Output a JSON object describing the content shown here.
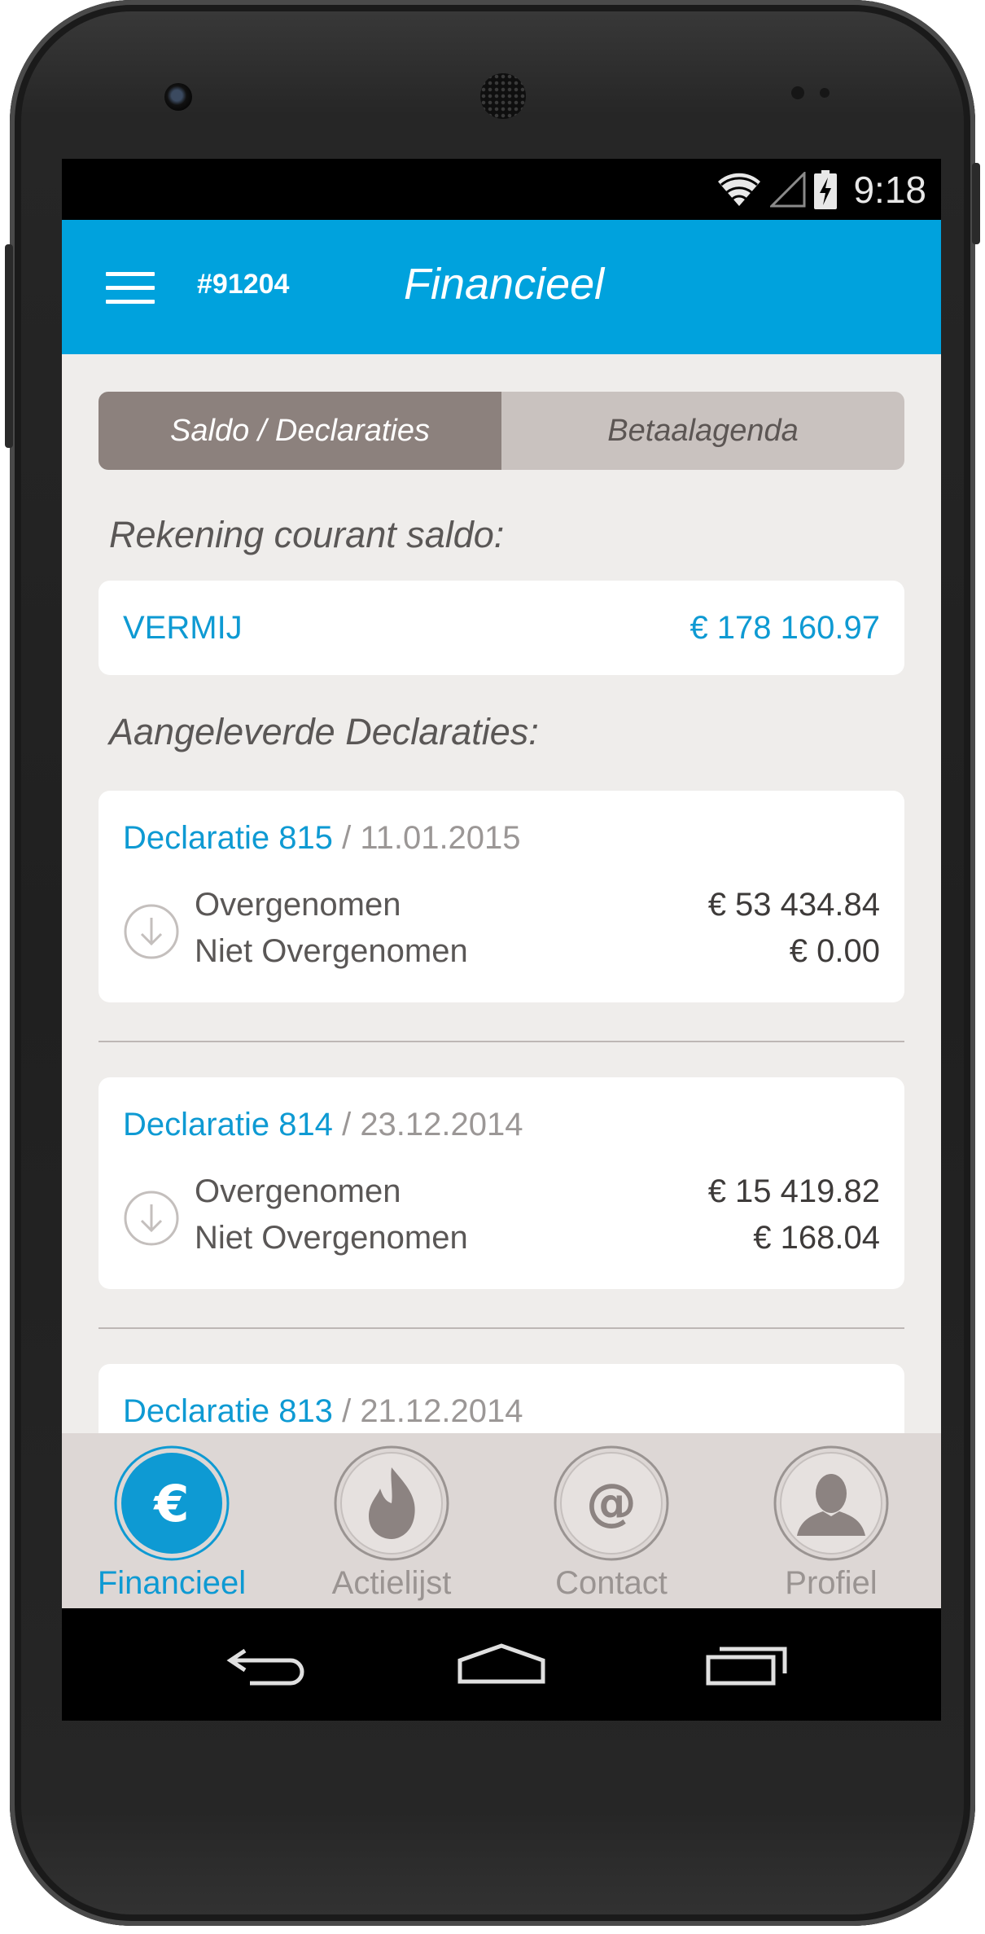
{
  "status_bar": {
    "time": "9:18",
    "icons": [
      "wifi-icon",
      "cellular-signal-icon",
      "battery-charging-icon"
    ]
  },
  "app_bar": {
    "menu_icon": "hamburger-menu-icon",
    "account_id": "#91204",
    "title": "Financieel",
    "background_color": "#00a2dd"
  },
  "tabs": [
    {
      "label": "Saldo / Declaraties",
      "active": true
    },
    {
      "label": "Betaalagenda",
      "active": false
    }
  ],
  "saldo": {
    "heading": "Rekening courant saldo:",
    "name": "VERMIJ",
    "amount": "€ 178 160.97"
  },
  "declarations": {
    "heading": "Aangeleverde Declaraties:",
    "items": [
      {
        "title": "Declaratie 815",
        "separator": "/",
        "date": "11.01.2015",
        "rows": [
          {
            "label": "Overgenomen",
            "amount": "€ 53 434.84"
          },
          {
            "label": "Niet Overgenomen",
            "amount": "€ 0.00"
          }
        ]
      },
      {
        "title": "Declaratie 814",
        "separator": "/",
        "date": "23.12.2014",
        "rows": [
          {
            "label": "Overgenomen",
            "amount": "€ 15 419.82"
          },
          {
            "label": "Niet Overgenomen",
            "amount": "€ 168.04"
          }
        ]
      },
      {
        "title": "Declaratie 813",
        "separator": "/",
        "date": "21.12.2014",
        "rows": []
      }
    ]
  },
  "bottom_nav": [
    {
      "label": "Financieel",
      "icon": "euro-icon",
      "active": true
    },
    {
      "label": "Actielijst",
      "icon": "flame-icon",
      "active": false
    },
    {
      "label": "Contact",
      "icon": "at-sign-icon",
      "active": false
    },
    {
      "label": "Profiel",
      "icon": "person-icon",
      "active": false
    }
  ],
  "system_nav": [
    "back-icon",
    "home-icon",
    "recent-apps-icon"
  ],
  "colors": {
    "accent": "#0e9ad3",
    "tab_active": "#8c817d",
    "tab_inactive": "#c9c2bf",
    "content_bg": "#efedeb",
    "nav_bg": "#ddd7d5"
  }
}
